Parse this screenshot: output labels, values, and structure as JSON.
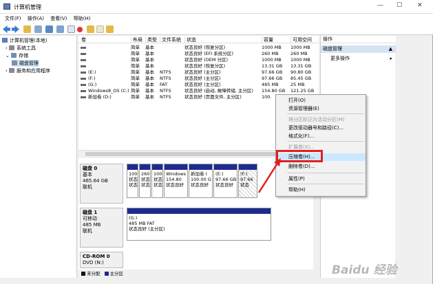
{
  "window": {
    "title": "计算机管理"
  },
  "menu": [
    "文件(F)",
    "操作(A)",
    "查看(V)",
    "帮助(H)"
  ],
  "tree": {
    "root": "计算机管理(本地)",
    "items": [
      "系统工具",
      "存储",
      "磁盘管理",
      "服务和应用程序"
    ]
  },
  "columns": [
    "卷",
    "布局",
    "类型",
    "文件系统",
    "状态",
    "容量",
    "可用空间"
  ],
  "volumes": [
    {
      "name": "",
      "layout": "简单",
      "type": "基本",
      "fs": "",
      "status": "状态良好 (恢复分区)",
      "cap": "1000 MB",
      "free": "1000 MB"
    },
    {
      "name": "",
      "layout": "简单",
      "type": "基本",
      "fs": "",
      "status": "状态良好 (EFI 系统分区)",
      "cap": "260 MB",
      "free": "260 MB"
    },
    {
      "name": "",
      "layout": "简单",
      "type": "基本",
      "fs": "",
      "status": "状态良好 (OEM 分区)",
      "cap": "1000 MB",
      "free": "1000 MB"
    },
    {
      "name": "",
      "layout": "简单",
      "type": "基本",
      "fs": "",
      "status": "状态良好 (恢复分区)",
      "cap": "13.31 GB",
      "free": "13.31 GB"
    },
    {
      "name": "(E:)",
      "layout": "简单",
      "type": "基本",
      "fs": "NTFS",
      "status": "状态良好 (主分区)",
      "cap": "97.66 GB",
      "free": "90.80 GB"
    },
    {
      "name": "(F:)",
      "layout": "简单",
      "type": "基本",
      "fs": "NTFS",
      "status": "状态良好 (主分区)",
      "cap": "97.66 GB",
      "free": "85.45 GB"
    },
    {
      "name": "(G:)",
      "layout": "简单",
      "type": "基本",
      "fs": "FAT",
      "status": "状态良好 (主分区)",
      "cap": "485 MB",
      "free": "25 MB"
    },
    {
      "name": "Windows8_OS (C:)",
      "layout": "简单",
      "type": "基本",
      "fs": "NTFS",
      "status": "状态良好 (启动, 故障转储, 主分区)",
      "cap": "154.80 GB",
      "free": "121.25 GB"
    },
    {
      "name": "新加卷 (D:)",
      "layout": "简单",
      "type": "基本",
      "fs": "NTFS",
      "status": "状态良好 (页面文件, 主分区)",
      "cap": "100.",
      "free": ""
    }
  ],
  "disk0": {
    "name": "磁盘 0",
    "kind": "基本",
    "size": "465.64 GB",
    "state": "联机",
    "parts": [
      {
        "l1": "1000",
        "l2": "状态"
      },
      {
        "l1": "260",
        "l2": "状态"
      },
      {
        "l1": "1000",
        "l2": "状态"
      },
      {
        "l1": "Windows",
        "l2": "154.80"
      },
      {
        "l1": "新加卷 (",
        "l2": "100.00 G"
      },
      {
        "l1": "(E:)",
        "l2": "97.66 GB"
      },
      {
        "l1": "(F:)",
        "l2": "97.66"
      }
    ],
    "parts3": [
      "状态",
      "状态",
      "状态",
      "状态良好",
      "状态良好",
      "状态良好",
      "状态"
    ]
  },
  "disk1": {
    "name": "磁盘 1",
    "kind": "可移动",
    "size": "485 MB",
    "state": "联机",
    "part": {
      "name": "(G:)",
      "info": "485 MB FAT",
      "status": "状态良好 (主分区)"
    }
  },
  "cdrom": {
    "name": "CD-ROM 0",
    "drive": "DVD (N:)"
  },
  "status_legend": [
    "未分配",
    "主分区"
  ],
  "actions": {
    "header": "操作",
    "section": "磁盘管理",
    "more": "更多操作"
  },
  "context_menu": {
    "items": [
      {
        "label": "打开(O)",
        "disabled": false
      },
      {
        "label": "资源管理器(E)",
        "disabled": false
      },
      {
        "label": "将分区标记为活动分区(M)",
        "disabled": true
      },
      {
        "label": "更改驱动器号和路径(C)...",
        "disabled": false
      },
      {
        "label": "格式化(F)...",
        "disabled": false
      },
      {
        "label": "扩展卷(X)...",
        "disabled": true
      },
      {
        "label": "压缩卷(H)...",
        "disabled": false
      },
      {
        "label": "删除卷(D)...",
        "disabled": false
      },
      {
        "label": "属性(P)",
        "disabled": false
      },
      {
        "label": "帮助(H)",
        "disabled": false
      }
    ]
  },
  "watermark": "Baidu 经验",
  "colors": {
    "partition_bar": "#1d2b8f",
    "highlight": "#cce8ff",
    "red": "#e02020"
  }
}
